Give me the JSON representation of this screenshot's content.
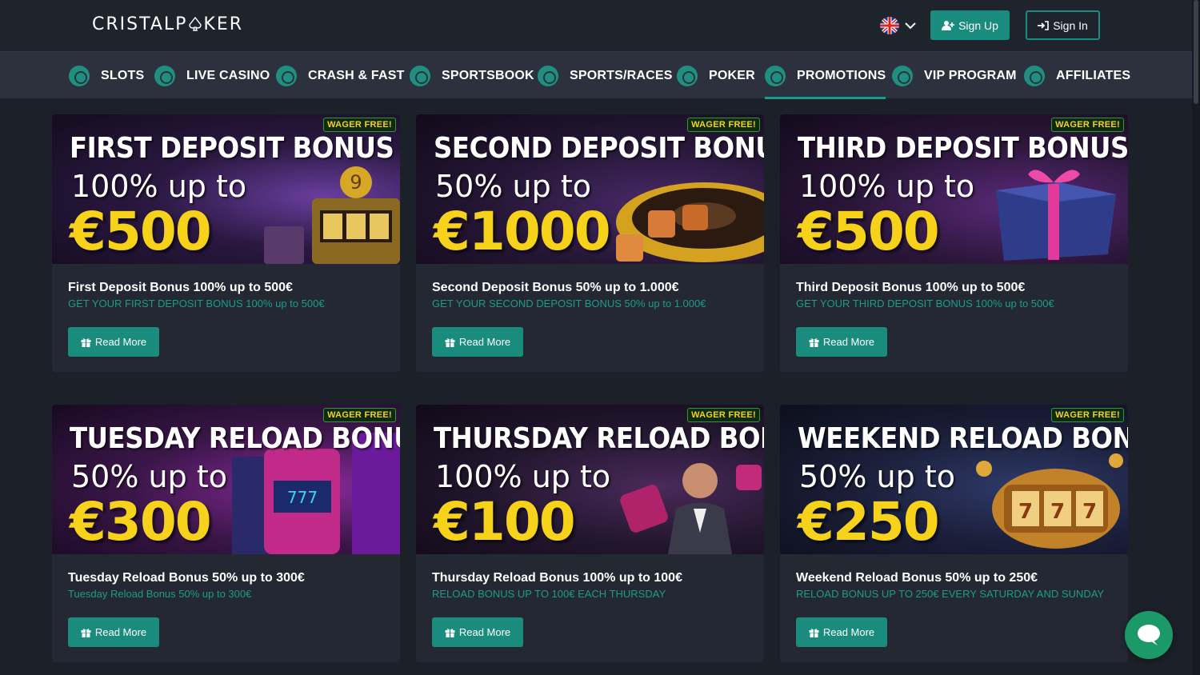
{
  "header": {
    "logo_text": "CRISTALPOKER",
    "language": "English (UK)",
    "signup_label": "Sign Up",
    "signin_label": "Sign In"
  },
  "nav": {
    "items": [
      {
        "label": "SLOTS",
        "icon": "slots-icon"
      },
      {
        "label": "LIVE CASINO",
        "icon": "live-casino-icon"
      },
      {
        "label": "CRASH & FAST",
        "icon": "rocket-icon"
      },
      {
        "label": "SPORTSBOOK",
        "icon": "soccer-ball-icon"
      },
      {
        "label": "SPORTS/RACES",
        "icon": "gamepad-icon"
      },
      {
        "label": "POKER",
        "icon": "poker-icon"
      },
      {
        "label": "PROMOTIONS",
        "icon": "gift-icon",
        "active": true
      },
      {
        "label": "VIP PROGRAM",
        "icon": "crown-icon"
      },
      {
        "label": "AFFILIATES",
        "icon": "affiliates-icon"
      }
    ]
  },
  "promotions": [
    {
      "banner_title": "FIRST DEPOSIT BONUS",
      "banner_sub": "100% up to",
      "banner_amount": "€500",
      "badge": "WAGER FREE!",
      "title": "First Deposit Bonus 100% up to 500€",
      "desc": "GET YOUR FIRST DEPOSIT BONUS 100% up to 500€",
      "button": "Read More"
    },
    {
      "banner_title": "SECOND DEPOSIT BONUS",
      "banner_sub": "50% up to",
      "banner_amount": "€1000",
      "badge": "WAGER FREE!",
      "title": "Second Deposit Bonus 50% up to 1.000€",
      "desc": "GET YOUR SECOND DEPOSIT BONUS 50% up to 1.000€",
      "button": "Read More"
    },
    {
      "banner_title": "THIRD DEPOSIT BONUS",
      "banner_sub": "100% up to",
      "banner_amount": "€500",
      "badge": "WAGER FREE!",
      "title": "Third Deposit Bonus 100% up to 500€",
      "desc": "GET YOUR THIRD DEPOSIT BONUS 100% up to 500€",
      "button": "Read More"
    },
    {
      "banner_title": "TUESDAY RELOAD BONUS",
      "banner_sub": "50% up to",
      "banner_amount": "€300",
      "badge": "WAGER FREE!",
      "title": "Tuesday Reload Bonus 50% up to 300€",
      "desc": "Tuesday Reload Bonus 50% up to 300€",
      "button": "Read More"
    },
    {
      "banner_title": "THURSDAY RELOAD BONUS",
      "banner_sub": "100% up to",
      "banner_amount": "€100",
      "badge": "WAGER FREE!",
      "title": "Thursday Reload Bonus 100% up to 100€",
      "desc": "RELOAD BONUS UP TO 100€ EACH THURSDAY",
      "button": "Read More"
    },
    {
      "banner_title": "WEEKEND RELOAD BONUS",
      "banner_sub": "50% up to",
      "banner_amount": "€250",
      "badge": "WAGER FREE!",
      "title": "Weekend Reload Bonus 50% up to 250€",
      "desc": "RELOAD BONUS UP TO 250€ EVERY SATURDAY AND SUNDAY",
      "button": "Read More"
    }
  ],
  "colors": {
    "accent": "#1a8c7e",
    "badge_text": "#f4d31c",
    "amount": "#f7d21a",
    "desc_text": "#1b9c89"
  }
}
